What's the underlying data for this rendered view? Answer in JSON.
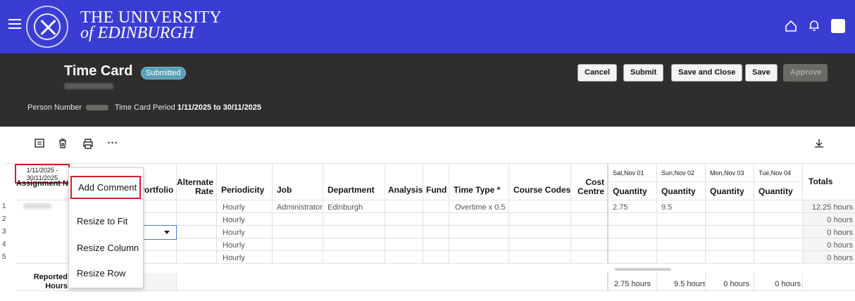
{
  "brand": {
    "line1": "THE UNIVERSITY",
    "line2": "of EDINBURGH"
  },
  "header": {
    "title": "Time Card",
    "status": "Submitted",
    "person_label": "Person Number",
    "period_label": "Time Card Period",
    "period_value": "1/11/2025 to 30/11/2025",
    "buttons": [
      "Cancel",
      "Submit",
      "Save and Close",
      "Save",
      "Approve"
    ]
  },
  "toolbar": {
    "icons": [
      "comment-icon",
      "delete-icon",
      "print-icon",
      "more-icon",
      "download-icon"
    ],
    "more_label": "···"
  },
  "grid": {
    "date_range": "1/11/2025 - 30/11/2025",
    "columns": {
      "assignment": "Assignment Number",
      "portfolio": "Portfolio",
      "alternate_rate": "Alternate Rate",
      "periodicity": "Periodicity",
      "job": "Job",
      "department": "Department",
      "analysis": "Analysis",
      "fund": "Fund",
      "time_type": "Time Type *",
      "course_codes": "Course Codes",
      "cost_centre": "Cost Centre",
      "totals": "Totals"
    },
    "days": [
      {
        "date": "Sat,Nov 01",
        "label": "Quantity",
        "total": "2.75 hours"
      },
      {
        "date": "Sun,Nov 02",
        "label": "Quantity",
        "total": "9.5 hours"
      },
      {
        "date": "Mon,Nov 03",
        "label": "Quantity",
        "total": "0 hours"
      },
      {
        "date": "Tue,Nov 04",
        "label": "Quantity",
        "total": "0 hours"
      }
    ],
    "rows": [
      {
        "num": "1",
        "periodicity": "Hourly",
        "job": "Administrator",
        "department": "Edinburgh",
        "time_type": "Overtime x 0.5",
        "q1": "2.75",
        "q2": "9.5",
        "total": "12.25 hours"
      },
      {
        "num": "2",
        "periodicity": "Hourly",
        "job": "",
        "department": "",
        "time_type": "",
        "q1": "",
        "q2": "",
        "total": "0 hours"
      },
      {
        "num": "3",
        "periodicity": "Hourly",
        "job": "",
        "department": "",
        "time_type": "",
        "q1": "",
        "q2": "",
        "total": "0 hours"
      },
      {
        "num": "4",
        "periodicity": "Hourly",
        "job": "",
        "department": "",
        "time_type": "",
        "q1": "",
        "q2": "",
        "total": "0 hours"
      },
      {
        "num": "5",
        "periodicity": "Hourly",
        "job": "",
        "department": "",
        "time_type": "",
        "q1": "",
        "q2": "",
        "total": "0 hours"
      }
    ],
    "reported_label": "Reported Hours"
  },
  "context_menu": {
    "items": [
      "Add Comment",
      "Resize to Fit",
      "Resize Column",
      "Resize Row"
    ]
  }
}
